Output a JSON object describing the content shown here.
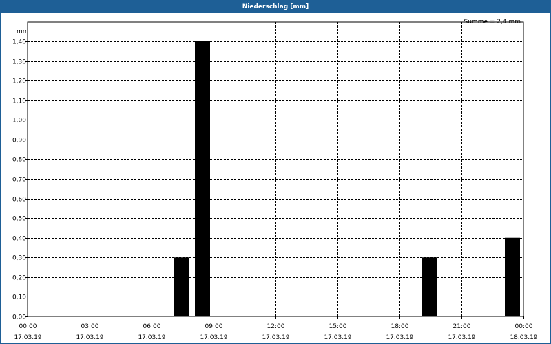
{
  "window": {
    "title": "Niederschlag [mm]"
  },
  "chart_data": {
    "type": "bar",
    "title": "Niederschlag [mm]",
    "annotation": "Summe = 2,4 mm",
    "ylabel": "mm",
    "xlabel": "",
    "ylim": [
      0,
      1.4
    ],
    "ytick_step": 0.1,
    "y_ticks": [
      "0,00",
      "0,10",
      "0,20",
      "0,30",
      "0,40",
      "0,50",
      "0,60",
      "0,70",
      "0,80",
      "0,90",
      "1,00",
      "1,10",
      "1,20",
      "1,30",
      "1,40"
    ],
    "x_range_hours": [
      0,
      24
    ],
    "x_ticks": [
      {
        "hour": 0,
        "time": "00:00",
        "date": "17.03.19"
      },
      {
        "hour": 3,
        "time": "03:00",
        "date": "17.03.19"
      },
      {
        "hour": 6,
        "time": "06:00",
        "date": "17.03.19"
      },
      {
        "hour": 9,
        "time": "09:00",
        "date": "17.03.19"
      },
      {
        "hour": 12,
        "time": "12:00",
        "date": "17.03.19"
      },
      {
        "hour": 15,
        "time": "15:00",
        "date": "17.03.19"
      },
      {
        "hour": 18,
        "time": "18:00",
        "date": "17.03.19"
      },
      {
        "hour": 21,
        "time": "21:00",
        "date": "17.03.19"
      },
      {
        "hour": 24,
        "time": "00:00",
        "date": "18.03.19"
      }
    ],
    "bars": [
      {
        "hour": 8,
        "value": 0.3
      },
      {
        "hour": 9,
        "value": 1.4
      },
      {
        "hour": 20,
        "value": 0.3
      },
      {
        "hour": 24,
        "value": 0.4
      }
    ],
    "grid": true,
    "colors": {
      "bar": "#000000",
      "grid": "#000000",
      "title_bar": "#1e5f96"
    }
  }
}
